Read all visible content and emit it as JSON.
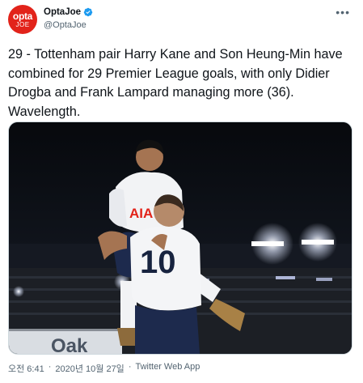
{
  "account": {
    "display_name": "OptaJoe",
    "handle": "@OptaJoe",
    "avatar_line1": "opta",
    "avatar_line2": "JOE",
    "verified": true,
    "brand_color": "#e2231a"
  },
  "tweet": {
    "text": "29 - Tottenham pair Harry Kane and Son Heung-Min have combined for 29 Premier League goals, with only Didier Drogba and Frank Lampard managing more (36). Wavelength.",
    "more_icon": "more-horizontal-icon"
  },
  "media": {
    "shirt_sponsor": "AIA",
    "shirt_number": "10",
    "board_text": "Oak"
  },
  "meta": {
    "time": "오전 6:41",
    "date": "2020년 10월 27일",
    "source": "Twitter Web App",
    "separator": "·"
  }
}
